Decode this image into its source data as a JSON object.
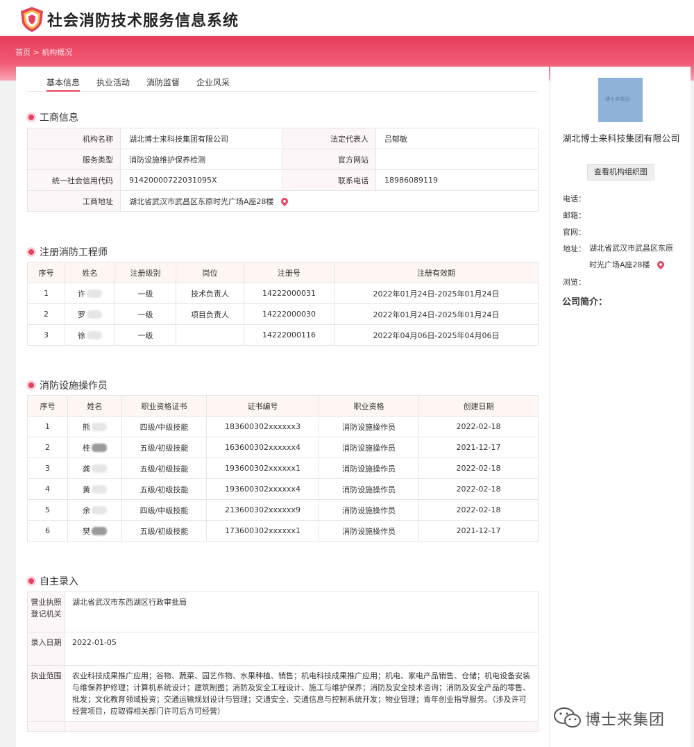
{
  "header": {
    "title": "社会消防技术服务信息系统"
  },
  "breadcrumb": {
    "home": "首页",
    "sep": ">",
    "current": "机构概况"
  },
  "tabs": [
    "基本信息",
    "执业活动",
    "消防监督",
    "企业风采"
  ],
  "business": {
    "title": "工商信息",
    "org_name_label": "机构名称",
    "org_name": "湖北博士来科技集团有限公司",
    "legal_rep_label": "法定代表人",
    "legal_rep": "吕郁敏",
    "service_type_label": "服务类型",
    "service_type": "消防设施维护保养检测",
    "website_label": "官方网站",
    "website": "",
    "credit_code_label": "统一社会信用代码",
    "credit_code": "91420000722031095X",
    "phone_label": "联系电话",
    "phone": "18986089119",
    "address_label": "工商地址",
    "address": "湖北省武汉市武昌区东原时光广场A座28楼"
  },
  "engineers": {
    "title": "注册消防工程师",
    "headers": [
      "序号",
      "姓名",
      "注册级别",
      "岗位",
      "注册号",
      "注册有效期"
    ],
    "rows": [
      {
        "no": "1",
        "name": "许",
        "level": "一级",
        "post": "技术负责人",
        "reg": "14222000031",
        "valid": "2022年01月24日-2025年01月24日"
      },
      {
        "no": "2",
        "name": "罗",
        "level": "一级",
        "post": "项目负责人",
        "reg": "14222000030",
        "valid": "2022年01月24日-2025年01月24日"
      },
      {
        "no": "3",
        "name": "徐",
        "level": "一级",
        "post": "",
        "reg": "14222000116",
        "valid": "2022年04月06日-2025年04月06日"
      }
    ]
  },
  "operators": {
    "title": "消防设施操作员",
    "headers": [
      "序号",
      "姓名",
      "职业资格证书",
      "证书编号",
      "职业资格",
      "创建日期"
    ],
    "rows": [
      {
        "no": "1",
        "name": "熊",
        "cert": "四级/中级技能",
        "code": "183600302xxxxxx3",
        "qual": "消防设施操作员",
        "date": "2022-02-18"
      },
      {
        "no": "2",
        "name": "桂",
        "cert": "五级/初级技能",
        "code": "163600302xxxxxx4",
        "qual": "消防设施操作员",
        "date": "2021-12-17"
      },
      {
        "no": "3",
        "name": "龚",
        "cert": "五级/初级技能",
        "code": "193600302xxxxxx1",
        "qual": "消防设施操作员",
        "date": "2022-02-18"
      },
      {
        "no": "4",
        "name": "黄",
        "cert": "五级/初级技能",
        "code": "193600302xxxxxx4",
        "qual": "消防设施操作员",
        "date": "2022-02-18"
      },
      {
        "no": "5",
        "name": "余",
        "cert": "四级/中级技能",
        "code": "213600302xxxxxx9",
        "qual": "消防设施操作员",
        "date": "2022-02-18"
      },
      {
        "no": "6",
        "name": "樊",
        "cert": "五级/初级技能",
        "code": "173600302xxxxxx1",
        "qual": "消防设施操作员",
        "date": "2021-12-17"
      }
    ]
  },
  "self_entry": {
    "title": "自主录入",
    "authority_label": "营业执照登记机关",
    "authority": "湖北省武汉市东西湖区行政审批局",
    "date_label": "录入日期",
    "date": "2022-01-05",
    "scope_label": "执业范围",
    "scope": "农业科技成果推广应用；谷物、蔬菜、园艺作物、水果种植、销售；机电科技成果推广应用；机电、家电产品销售、仓储；机电设备安装与维保养护修理；计算机系统设计；建筑制图；消防及安全工程设计、施工与维护保养；消防及安全技术咨询；消防及安全产品的零售、批发；文化教育领域投资；交通运输规划设计与管理；交通安全、交通信息与控制系统开发；物业管理；青年创业指导服务。（涉及许可经营项目，应取得相关部门许可后方可经营）"
  },
  "sidebar": {
    "image_text": "博士来集团",
    "company_name": "湖北博士来科技集团有限公司",
    "org_chart_button": "查看机构组织图",
    "phone_label": "电话：",
    "email_label": "邮箱：",
    "website_label": "官网：",
    "address_label": "地址：",
    "address": "湖北省武汉市武昌区东原时光广场A座28楼",
    "views_label": "浏览：",
    "intro_label": "公司简介："
  },
  "watermark": {
    "text": "博士来集团"
  },
  "colors": {
    "accent": "#e8405d",
    "banner": "#f05a73"
  }
}
